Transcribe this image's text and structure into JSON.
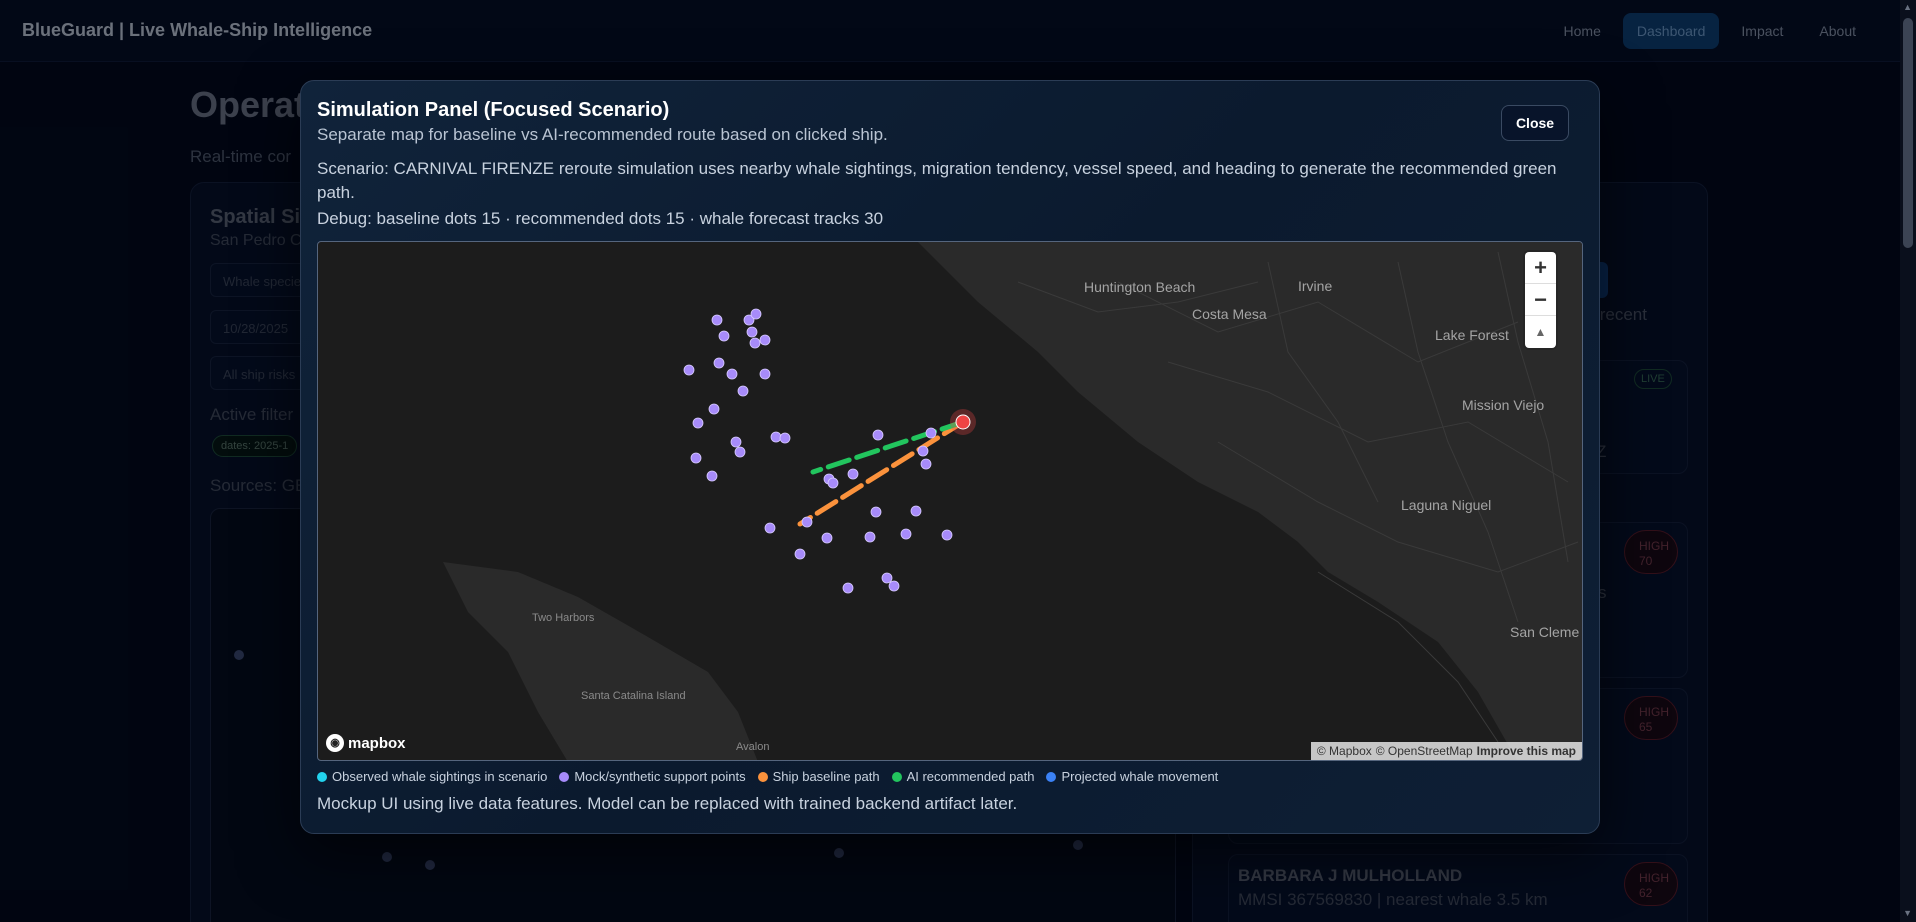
{
  "nav": {
    "brand": "BlueGuard | Live Whale-Ship Intelligence",
    "links": [
      "Home",
      "Dashboard",
      "Impact",
      "About"
    ]
  },
  "background": {
    "title": "Operat",
    "subtitle": "Real-time cor",
    "panel_title": "Spatial Si",
    "panel_sub": "San Pedro C",
    "whale_species_placeholder": "Whale specie",
    "date_value": "10/28/2025",
    "ship_risk_value": "All ship risks",
    "active_filters": "Active filter",
    "chip": "dates: 2025-1",
    "sources": "Sources: GE",
    "right_button": "N",
    "right_text": "ck recent",
    "live_badge": "LIVE",
    "z_text": "Z",
    "s_text": "s",
    "badges": [
      {
        "level": "HIGH",
        "score": "70"
      },
      {
        "level": "HIGH",
        "score": "65"
      },
      {
        "level": "HIGH",
        "score": "62"
      }
    ],
    "ship_name": "BARBARA J MULHOLLAND",
    "ship_meta": "MMSI 367569830 | nearest whale 3.5 km"
  },
  "modal": {
    "title": "Simulation Panel (Focused Scenario)",
    "subtitle": "Separate map for baseline vs AI-recommended route based on clicked ship.",
    "close_label": "Close",
    "scenario": "Scenario: CARNIVAL FIRENZE reroute simulation uses nearby whale sightings, migration tendency, vessel speed, and heading to generate the recommended green path.",
    "debug": "Debug: baseline dots 15 · recommended dots 15 · whale forecast tracks 30",
    "footnote": "Mockup UI using live data features. Model can be replaced with trained backend artifact later."
  },
  "map": {
    "labels": {
      "huntington_beach": "Huntington Beach",
      "irvine": "Irvine",
      "costa_mesa": "Costa Mesa",
      "lake_forest": "Lake Forest",
      "mission_viejo": "Mission Viejo",
      "laguna_niguel": "Laguna Niguel",
      "san_clemente": "San Cleme",
      "two_harbors": "Two Harbors",
      "santa_catalina": "Santa Catalina Island",
      "avalon": "Avalon"
    },
    "zoom_in": "+",
    "zoom_out": "−",
    "compass": "▲",
    "logo_text": "mapbox",
    "attribution_mapbox": "© Mapbox",
    "attribution_osm": "© OpenStreetMap",
    "improve": "Improve this map",
    "colors": {
      "water": "#1c1c1c",
      "land": "#2b2b2b",
      "mock_point": "#a78bfa",
      "baseline": "#fb923c",
      "recommended": "#22c55e",
      "ship": "#ef4444",
      "observed": "#22d3ee",
      "projected": "#3b82f6"
    }
  },
  "legend": [
    {
      "label": "Observed whale sightings in scenario",
      "color": "#22d3ee"
    },
    {
      "label": "Mock/synthetic support points",
      "color": "#a78bfa"
    },
    {
      "label": "Ship baseline path",
      "color": "#fb923c"
    },
    {
      "label": "AI recommended path",
      "color": "#22c55e"
    },
    {
      "label": "Projected whale movement",
      "color": "#3b82f6"
    }
  ]
}
